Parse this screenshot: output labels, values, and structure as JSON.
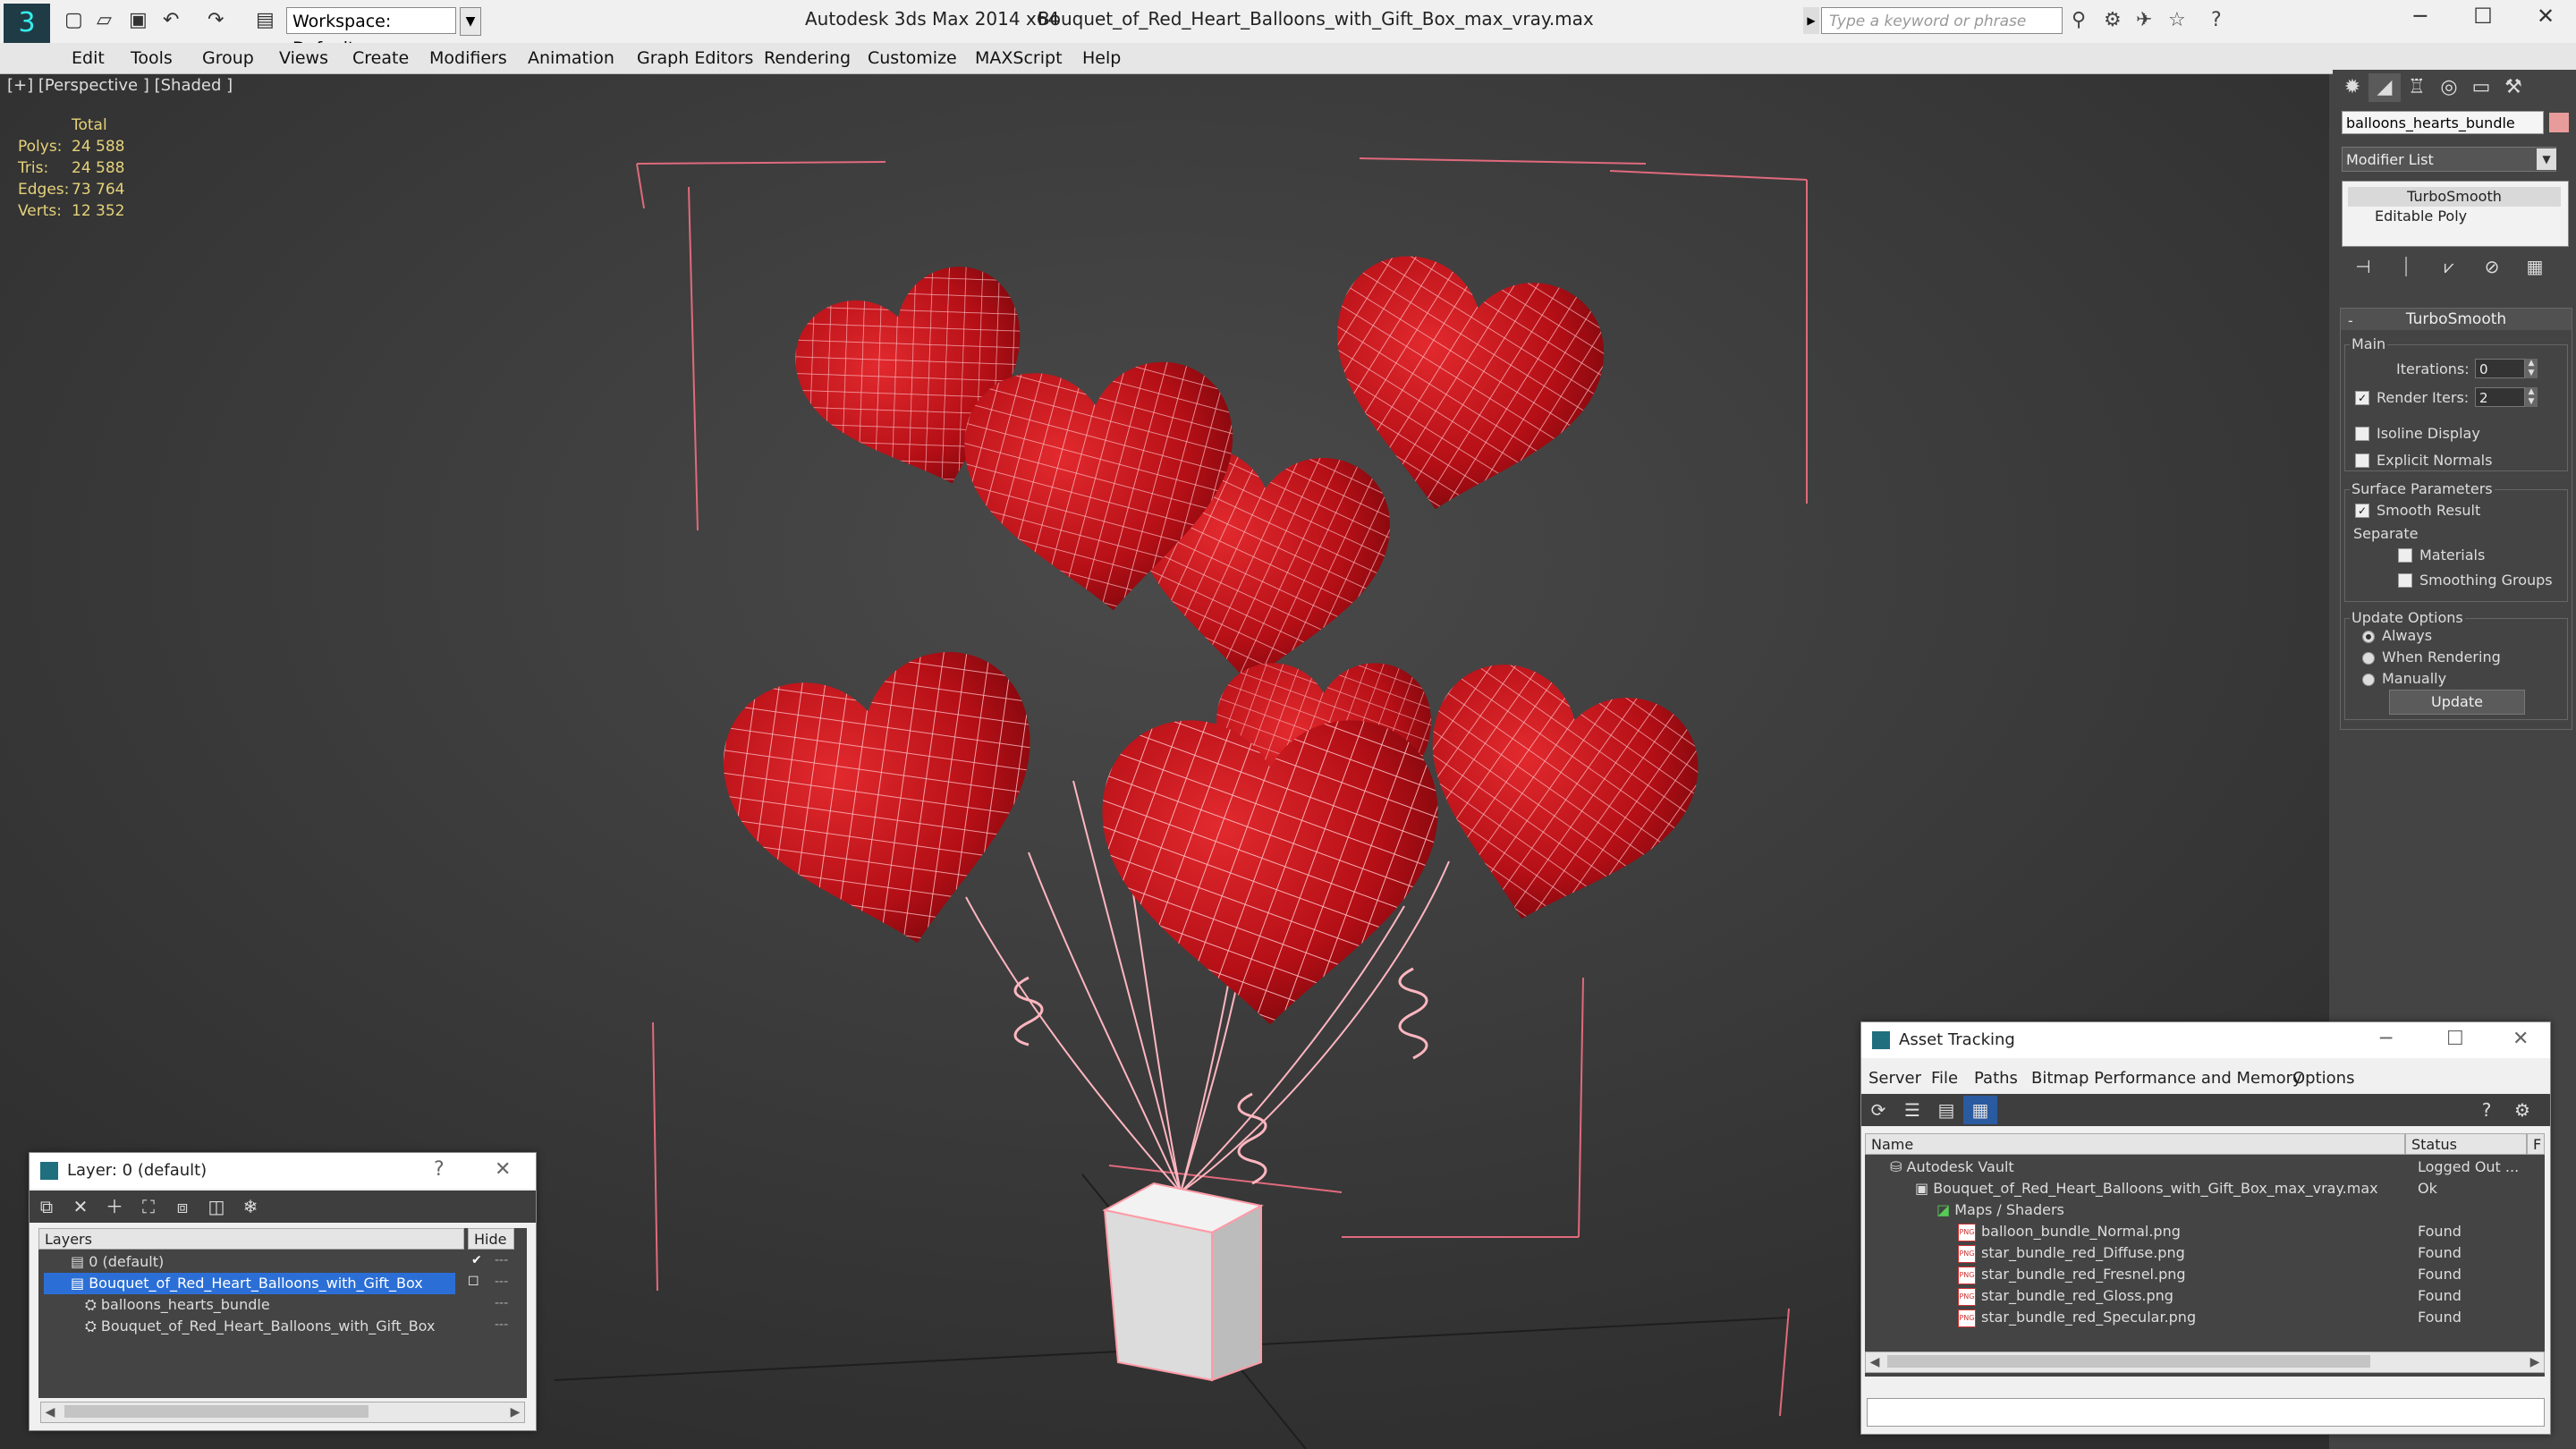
{
  "titlebar": {
    "app_title": "Autodesk 3ds Max  2014 x64",
    "file_title": "Bouquet_of_Red_Heart_Balloons_with_Gift_Box_max_vray.max",
    "workspace": "Workspace: Default",
    "search_placeholder": "Type a keyword or phrase"
  },
  "menu": [
    "Edit",
    "Tools",
    "Group",
    "Views",
    "Create",
    "Modifiers",
    "Animation",
    "Graph Editors",
    "Rendering",
    "Customize",
    "MAXScript",
    "Help"
  ],
  "viewport": {
    "label": "[+] [Perspective ] [Shaded ]",
    "stats": {
      "header": "Total",
      "rows": [
        {
          "label": "Polys:",
          "value": "24 588"
        },
        {
          "label": "Tris:",
          "value": "24 588"
        },
        {
          "label": "Edges:",
          "value": "73 764"
        },
        {
          "label": "Verts:",
          "value": "12 352"
        }
      ]
    }
  },
  "command_panel": {
    "object_name": "balloons_hearts_bundle",
    "object_color": "#e89b9b",
    "modifier_list": "Modifier List",
    "stack": [
      "TurboSmooth",
      "Editable Poly"
    ],
    "rollout_title": "TurboSmooth",
    "main_label": "Main",
    "iterations_label": "Iterations:",
    "iterations_value": "0",
    "render_iters_label": "Render Iters:",
    "render_iters_value": "2",
    "isoline": "Isoline Display",
    "explicit_normals": "Explicit Normals",
    "surface_params": "Surface Parameters",
    "smooth_result": "Smooth Result",
    "separate": "Separate",
    "materials": "Materials",
    "smoothing_groups": "Smoothing Groups",
    "update_options": "Update Options",
    "always": "Always",
    "when_rendering": "When Rendering",
    "manually": "Manually",
    "update_button": "Update"
  },
  "layer_window": {
    "title": "Layer: 0 (default)",
    "help": "?",
    "col_layers": "Layers",
    "col_hide": "Hide",
    "rows": [
      {
        "name": "0 (default)",
        "indent": 1
      },
      {
        "name": "Bouquet_of_Red_Heart_Balloons_with_Gift_Box",
        "indent": 1
      },
      {
        "name": "balloons_hearts_bundle",
        "indent": 2
      },
      {
        "name": "Bouquet_of_Red_Heart_Balloons_with_Gift_Box",
        "indent": 2
      }
    ]
  },
  "asset_window": {
    "title": "Asset Tracking",
    "menu": [
      "Server",
      "File",
      "Paths",
      "Bitmap Performance and Memory",
      "Options"
    ],
    "col_name": "Name",
    "col_status": "Status",
    "col_extra": "F",
    "rows": [
      {
        "name": "Autodesk Vault",
        "status": "Logged Out ..."
      },
      {
        "name": "Bouquet_of_Red_Heart_Balloons_with_Gift_Box_max_vray.max",
        "status": "Ok"
      },
      {
        "name": "Maps / Shaders",
        "status": ""
      },
      {
        "name": "balloon_bundle_Normal.png",
        "status": "Found"
      },
      {
        "name": "star_bundle_red_Diffuse.png",
        "status": "Found"
      },
      {
        "name": "star_bundle_red_Fresnel.png",
        "status": "Found"
      },
      {
        "name": "star_bundle_red_Gloss.png",
        "status": "Found"
      },
      {
        "name": "star_bundle_red_Specular.png",
        "status": "Found"
      }
    ]
  },
  "colors": {
    "balloon": "#c8141b",
    "wire": "#ff8a95",
    "selection": "#2b6fd6"
  }
}
